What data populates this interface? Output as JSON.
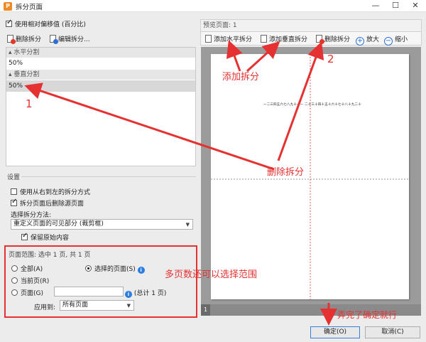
{
  "window": {
    "title": "拆分页面",
    "app_icon_letter": "P",
    "minimize": "—",
    "maximize": "☐",
    "close": "✕"
  },
  "left": {
    "use_relative_offset": {
      "label": "使用相对偏移值 (百分比)",
      "checked": true
    },
    "toolbar": {
      "delete_split": "删除拆分",
      "edit_split": "编辑拆分..."
    },
    "list": {
      "horizontal_group": "水平分割",
      "horizontal_value": "50%",
      "vertical_group": "垂直分割",
      "vertical_value": "50%"
    },
    "settings_label": "设置",
    "rtl_split": {
      "label": "使用从右到左的拆分方式",
      "checked": false
    },
    "delete_source": {
      "label": "拆分页面后删除源页面",
      "checked": true
    },
    "method_label": "选择拆分方法:",
    "method_value": "重定义页面的可见部分 (裁剪框)",
    "keep_original": {
      "label": "保留原始内容",
      "checked": true
    },
    "range": {
      "title": "页面范围: 选中 1 页, 共 1 页",
      "all": "全部(A)",
      "current": "当前页(R)",
      "pages": "页面(G)",
      "selected": "选择的页面(S)",
      "selected_checked": true,
      "pages_total": "(总计 1 页)",
      "apply_to_label": "应用到:",
      "apply_to_value": "所有页面",
      "info_glyph": "i"
    }
  },
  "preview": {
    "header": "预览页面: 1",
    "toolbar": {
      "add_horizontal": "添加水平拆分",
      "add_vertical": "添加垂直拆分",
      "delete": "删除拆分",
      "zoom_in": "放大",
      "zoom_out": "缩小",
      "zoom_in_glyph": "+",
      "zoom_out_glyph": "−"
    },
    "page_text": "一二三四五六七八九十十一 二十三十四十五十六十七十八十九二十",
    "page_number": "1"
  },
  "buttons": {
    "ok": "确定(O)",
    "cancel": "取消(C)"
  },
  "annotations": {
    "add_split": "添加拆分",
    "num_1": "1",
    "num_2": "2",
    "delete_split": "删除拆分",
    "range_hint": "多页数还可以选择范围",
    "done_hint": "弄完了确定就行"
  },
  "colors": {
    "annotation_red": "#e53131",
    "accent_blue": "#2a6fd1",
    "app_orange": "#f08a24"
  }
}
